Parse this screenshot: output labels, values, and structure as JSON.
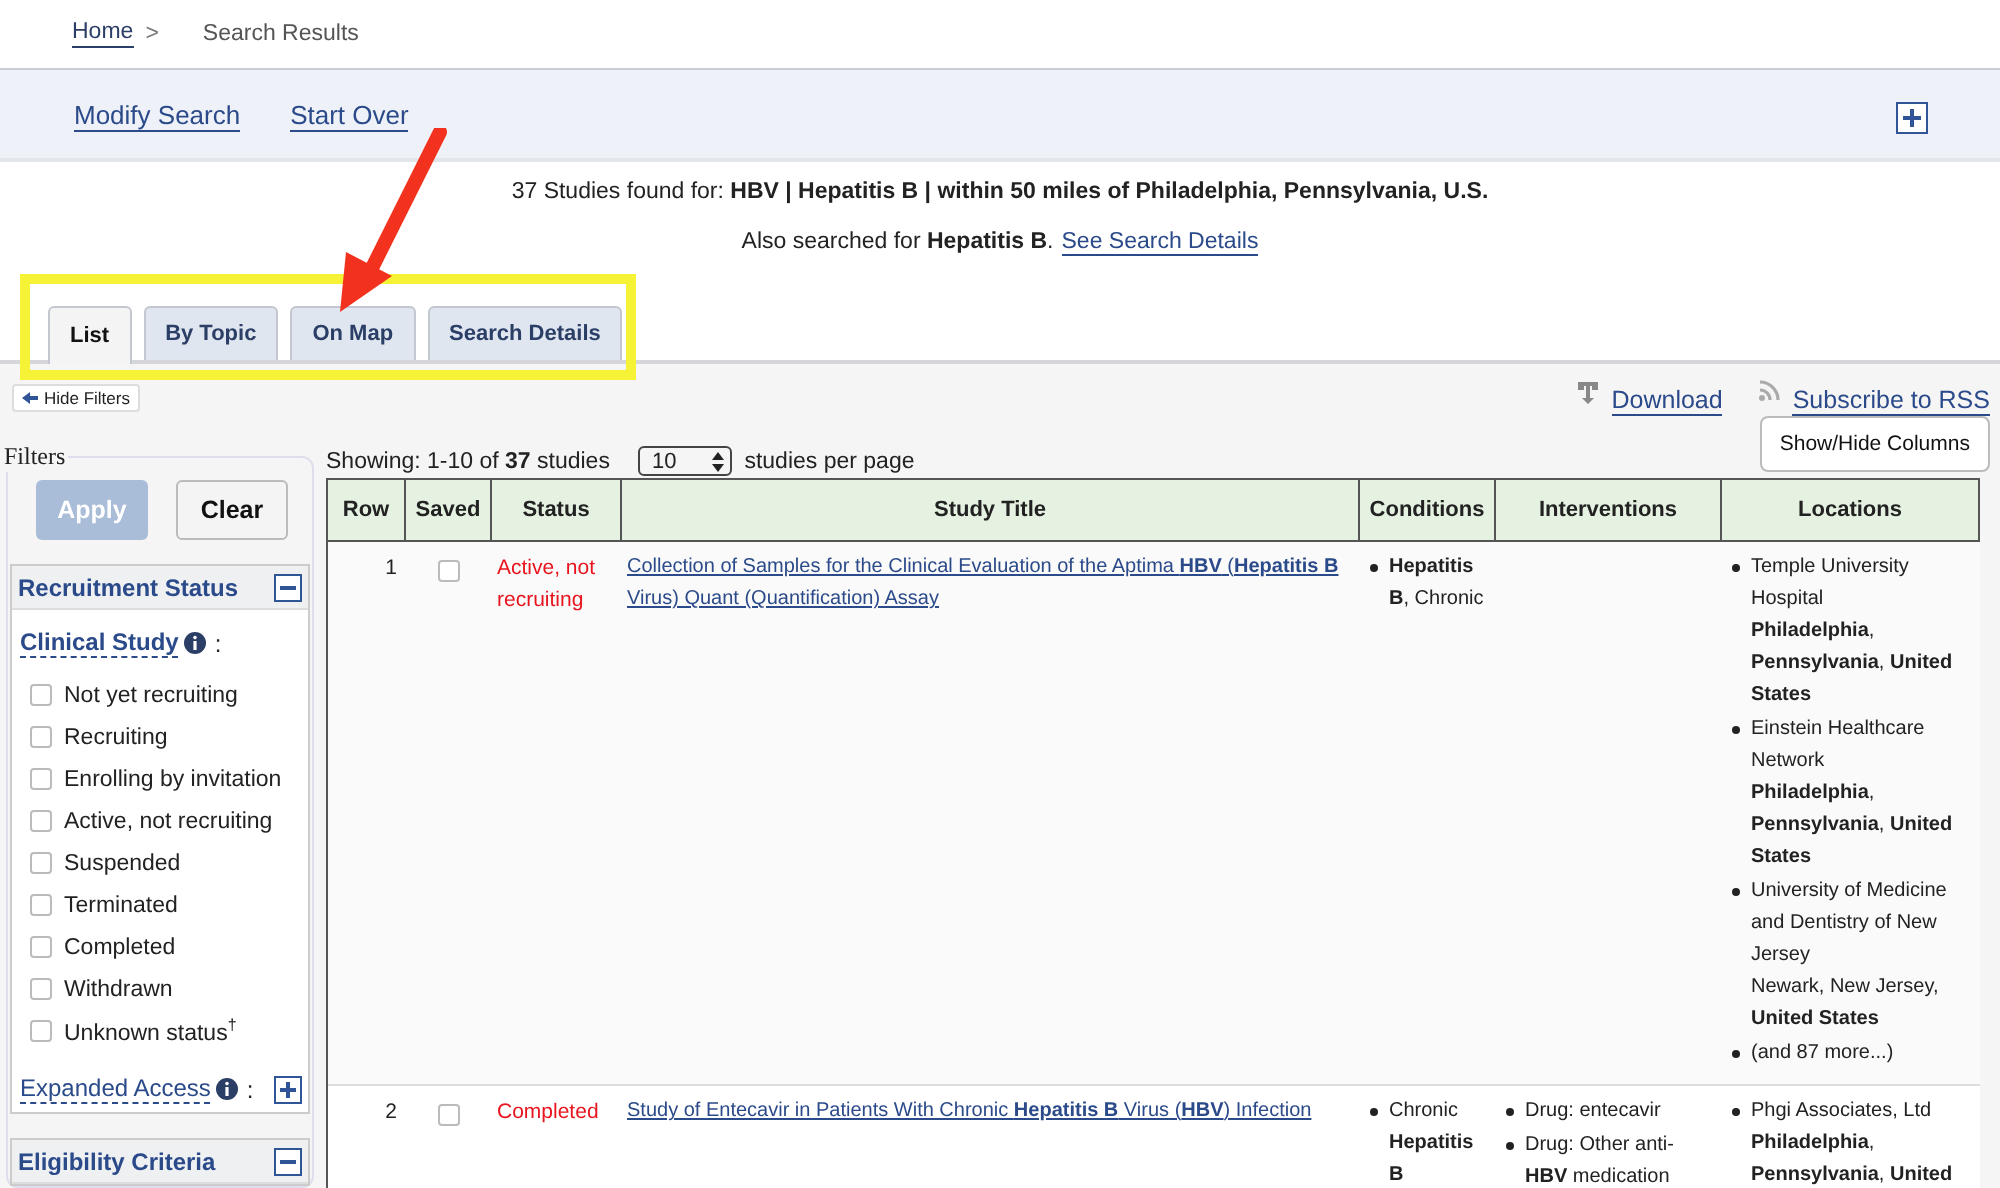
{
  "breadcrumb": {
    "home": "Home",
    "separator": ">",
    "current": "Search Results"
  },
  "actions": [
    {
      "label": "Modify Search"
    },
    {
      "label": "Start Over"
    }
  ],
  "summary": {
    "found": "37 Studies found for: **HBV | Hepatitis B | within 50 miles of Philadelphia, Pennsylvania, U.S.**",
    "also": "Also searched for **Hepatitis B**.",
    "link": "See Search Details"
  },
  "tabs": [
    {
      "label": "List",
      "selected": true
    },
    {
      "label": "By Topic",
      "selected": false
    },
    {
      "label": "On Map",
      "selected": false
    },
    {
      "label": "Search Details",
      "selected": false
    }
  ],
  "hide_filters": "Hide Filters",
  "tools": [
    {
      "kind": "download",
      "label": "Download"
    },
    {
      "kind": "rss",
      "label": "Subscribe to RSS"
    }
  ],
  "filters": {
    "legend": "Filters",
    "apply": {
      "label": "Apply",
      "disabled": true
    },
    "clear": "Clear",
    "panels": [
      {
        "title": "Recruitment Status",
        "expanded": true,
        "groups": [
          {
            "label": "Clinical Study",
            "colon": ":",
            "expanded": true,
            "options": [
              {
                "label": "Not yet recruiting",
                "checked": false
              },
              {
                "label": "Recruiting",
                "checked": false
              },
              {
                "label": "Enrolling by invitation",
                "checked": false
              },
              {
                "label": "Active, not recruiting",
                "checked": false
              },
              {
                "label": "Suspended",
                "checked": false
              },
              {
                "label": "Terminated",
                "checked": false
              },
              {
                "label": "Completed",
                "checked": false
              },
              {
                "label": "Withdrawn",
                "checked": false
              },
              {
                "label": "Unknown status$^{†}$",
                "checked": false
              }
            ]
          },
          {
            "label": "Expanded Access",
            "colon": ":",
            "expanded": false
          }
        ]
      },
      {
        "title": "Eligibility Criteria",
        "expanded": true
      }
    ]
  },
  "results": {
    "showing": "Showing: 1-10 of **37** studies",
    "per_page": "10",
    "per_page_label": "studies per page",
    "columns_button": "Show/Hide Columns",
    "columns": [
      "Row",
      "Saved",
      "Status",
      "Study Title",
      "Conditions",
      "Interventions",
      "Locations"
    ],
    "rows": [
      {
        "row": "1",
        "saved": false,
        "status": "Active, not recruiting",
        "title": "Collection of Samples for the Clinical Evaluation of the Aptima **HBV** (**Hepatitis B** Virus) Quant (Quantification) Assay",
        "conditions": [
          "**Hepatitis B**, Chronic"
        ],
        "interventions": [],
        "locations": [
          {
            "name": "Temple University Hospital",
            "place": "**Philadelphia**, **Pennsylvania**, **United States**"
          },
          {
            "name": "Einstein Healthcare Network",
            "place": "**Philadelphia**, **Pennsylvania**, **United States**"
          },
          {
            "name": "University of Medicine and Dentistry of New Jersey",
            "place": "Newark, New Jersey, **United States**"
          },
          {
            "name": "(and 87 more...)"
          }
        ]
      },
      {
        "row": "2",
        "saved": false,
        "status": "Completed",
        "title": "Study of Entecavir in Patients With Chronic **Hepatitis B** Virus (**HBV**) Infection",
        "conditions": [
          "Chronic **Hepatitis B**"
        ],
        "interventions": [
          "Drug: entecavir",
          "Drug: Other anti-**HBV** medication"
        ],
        "locations": [
          {
            "name": "Phgi Associates, Ltd",
            "place": "**Philadelphia**, **Pennsylvania**, **United**"
          }
        ]
      }
    ]
  }
}
